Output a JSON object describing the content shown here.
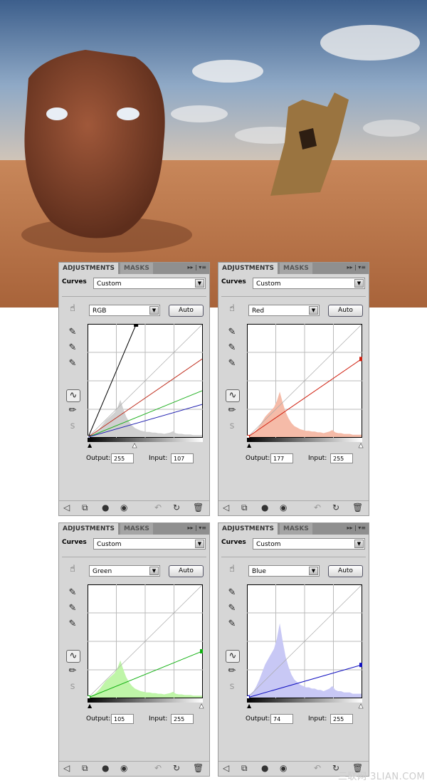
{
  "watermark": "三联网 3LIAN.COM",
  "panel_common": {
    "tab_active": "ADJUSTMENTS",
    "tab_inactive": "MASKS",
    "adjustment_label": "Curves",
    "preset": "Custom",
    "auto_label": "Auto",
    "output_label": "Output:",
    "input_label": "Input:"
  },
  "panels": [
    {
      "channel": "RGB",
      "output": "255",
      "input": "107"
    },
    {
      "channel": "Red",
      "output": "177",
      "input": "255"
    },
    {
      "channel": "Green",
      "output": "105",
      "input": "255"
    },
    {
      "channel": "Blue",
      "output": "74",
      "input": "255"
    }
  ],
  "chart_data": [
    {
      "type": "line",
      "title": "",
      "x_range": [
        0,
        255
      ],
      "y_range": [
        0,
        255
      ],
      "grid": true,
      "series": [
        {
          "color": "#000000",
          "points": [
            [
              0,
              0
            ],
            [
              107,
              255
            ]
          ]
        },
        {
          "color": "#c03020",
          "points": [
            [
              0,
              0
            ],
            [
              255,
              177
            ]
          ]
        },
        {
          "color": "#20b020",
          "points": [
            [
              0,
              0
            ],
            [
              255,
              105
            ]
          ]
        },
        {
          "color": "#2020b0",
          "points": [
            [
              0,
              0
            ],
            [
              255,
              74
            ]
          ]
        }
      ],
      "histogram_color": "#d0d0d0"
    },
    {
      "type": "line",
      "title": "",
      "x_range": [
        0,
        255
      ],
      "y_range": [
        0,
        255
      ],
      "grid": true,
      "series": [
        {
          "color": "#d02010",
          "points": [
            [
              0,
              0
            ],
            [
              255,
              177
            ]
          ]
        }
      ],
      "histogram_color": "#f5bba8"
    },
    {
      "type": "line",
      "title": "",
      "x_range": [
        0,
        255
      ],
      "y_range": [
        0,
        255
      ],
      "grid": true,
      "series": [
        {
          "color": "#10b010",
          "points": [
            [
              0,
              0
            ],
            [
              255,
              105
            ]
          ]
        }
      ],
      "histogram_color": "#bff5a8"
    },
    {
      "type": "line",
      "title": "",
      "x_range": [
        0,
        255
      ],
      "y_range": [
        0,
        255
      ],
      "grid": true,
      "series": [
        {
          "color": "#1010c0",
          "points": [
            [
              0,
              0
            ],
            [
              255,
              74
            ]
          ]
        }
      ],
      "histogram_color": "#c8c8f5"
    }
  ]
}
